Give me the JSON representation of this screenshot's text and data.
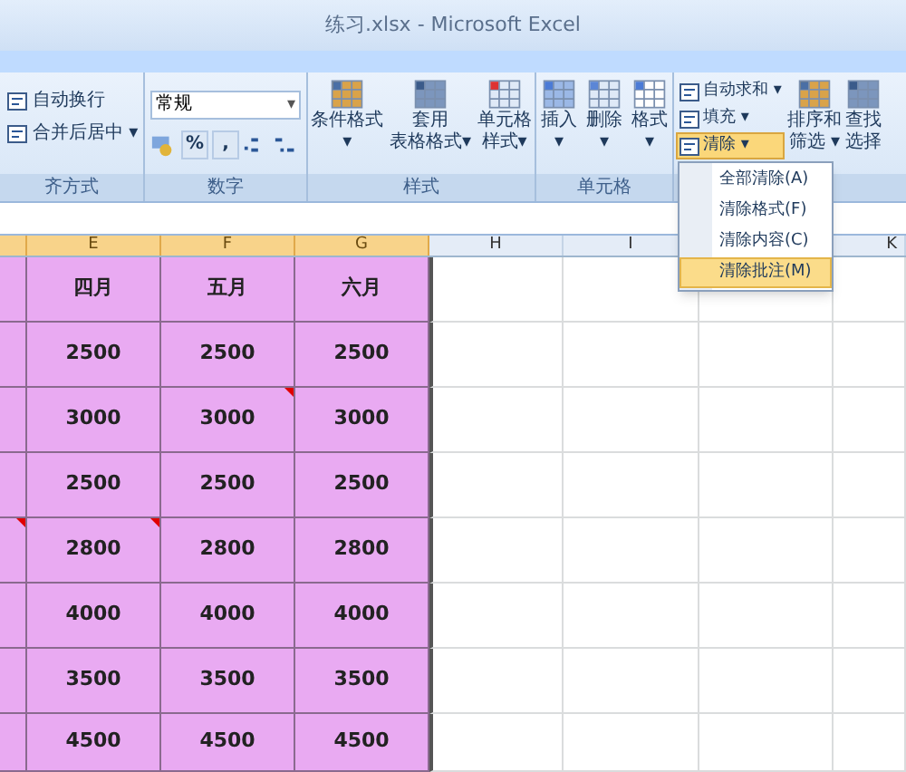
{
  "window": {
    "title": "练习.xlsx - Microsoft Excel"
  },
  "ribbon": {
    "groups": [
      {
        "kind": "alignment",
        "label": "齐方式",
        "buttons": [
          {
            "label": "自动换行"
          },
          {
            "label": "合并后居中",
            "caret": "▾"
          }
        ]
      },
      {
        "kind": "number",
        "label": "数字",
        "format": "常规",
        "caret": "▾",
        "buttons": [
          {
            "label": "%"
          },
          {
            "label": ","
          }
        ]
      },
      {
        "kind": "large",
        "label": "样式",
        "buttons": [
          {
            "lines": [
              "条件格式",
              "▾"
            ]
          },
          {
            "lines": [
              "套用",
              "表格格式▾"
            ]
          },
          {
            "lines": [
              "单元格",
              "样式▾"
            ]
          }
        ]
      },
      {
        "kind": "large",
        "label": "单元格",
        "buttons": [
          {
            "lines": [
              "插入",
              "▾"
            ]
          },
          {
            "lines": [
              "删除",
              "▾"
            ]
          },
          {
            "lines": [
              "格式",
              "▾"
            ]
          }
        ]
      },
      {
        "kind": "editing",
        "small": [
          {
            "label": "自动求和 ▾",
            "selected": false
          },
          {
            "label": "填充 ▾",
            "selected": false
          },
          {
            "label": "清除 ▾",
            "selected": true
          }
        ],
        "buttons": [
          {
            "lines": [
              "排序和",
              "筛选 ▾"
            ]
          },
          {
            "lines": [
              "查找",
              "选择"
            ]
          }
        ]
      }
    ]
  },
  "menu": {
    "items": [
      {
        "label": "全部清除(A)",
        "selected": false
      },
      {
        "label": "清除格式(F)",
        "selected": false
      },
      {
        "label": "清除内容(C)",
        "selected": false
      },
      {
        "label": "清除批注(M)",
        "selected": true
      }
    ]
  },
  "sheet": {
    "columns": [
      {
        "selected": true
      },
      {
        "label": "E",
        "selected": true
      },
      {
        "label": "F",
        "selected": true
      },
      {
        "label": "G",
        "selected": true
      },
      {
        "label": "H",
        "selected": false
      },
      {
        "label": "I",
        "selected": false
      },
      {},
      {
        "label": "K",
        "selected": false
      }
    ],
    "rows": [
      [
        {},
        {
          "text": "四月",
          "comment": false
        },
        {
          "text": "五月",
          "comment": false
        },
        {
          "text": "六月",
          "comment": false
        }
      ],
      [
        {},
        {
          "text": "2500",
          "comment": false
        },
        {
          "text": "2500",
          "comment": false
        },
        {
          "text": "2500",
          "comment": false
        }
      ],
      [
        {},
        {
          "text": "3000",
          "comment": false
        },
        {
          "text": "3000",
          "comment": true
        },
        {
          "text": "3000",
          "comment": false
        }
      ],
      [
        {},
        {
          "text": "2500",
          "comment": false
        },
        {
          "text": "2500",
          "comment": false
        },
        {
          "text": "2500",
          "comment": false
        }
      ],
      [
        {
          "comment": true
        },
        {
          "text": "2800",
          "comment": true
        },
        {
          "text": "2800",
          "comment": false
        },
        {
          "text": "2800",
          "comment": false
        }
      ],
      [
        {},
        {
          "text": "4000",
          "comment": false
        },
        {
          "text": "4000",
          "comment": false
        },
        {
          "text": "4000",
          "comment": false
        }
      ],
      [
        {},
        {
          "text": "3500",
          "comment": false
        },
        {
          "text": "3500",
          "comment": false
        },
        {
          "text": "3500",
          "comment": false
        }
      ],
      [
        {},
        {
          "text": "4500",
          "comment": false
        },
        {
          "text": "4500",
          "comment": false
        },
        {
          "text": "4500",
          "comment": false
        }
      ]
    ]
  }
}
